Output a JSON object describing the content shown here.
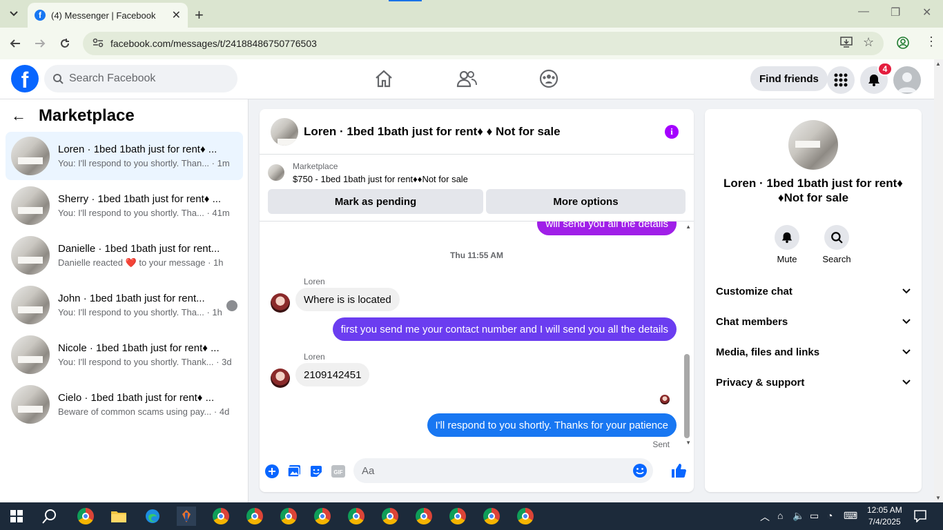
{
  "browser": {
    "tab_title": "(4) Messenger | Facebook",
    "url": "facebook.com/messages/t/24188486750776503"
  },
  "fb_header": {
    "search_placeholder": "Search Facebook",
    "find_friends": "Find friends",
    "notification_count": "4"
  },
  "left_panel": {
    "title": "Marketplace",
    "conversations": [
      {
        "name": "Loren · 1bed 1bath just for rent♦ ...",
        "preview": "You: I'll respond to you shortly. Than...",
        "time": "· 1m"
      },
      {
        "name": "Sherry · 1bed 1bath just for rent♦ ...",
        "preview": "You: I'll respond to you shortly. Tha...",
        "time": "· 41m"
      },
      {
        "name": "Danielle · 1bed 1bath just for rent...",
        "preview": "Danielle reacted ❤️ to your message",
        "time": "· 1h"
      },
      {
        "name": "John · 1bed 1bath just for rent...",
        "preview": "You: I'll respond to you shortly. Tha...",
        "time": "· 1h"
      },
      {
        "name": "Nicole · 1bed 1bath just for rent♦ ...",
        "preview": "You: I'll respond to you shortly. Thank...",
        "time": "· 3d"
      },
      {
        "name": "Cielo · 1bed 1bath just for rent♦ ...",
        "preview": "Beware of common scams using pay...",
        "time": "· 4d"
      }
    ]
  },
  "chat": {
    "header_name": "Loren · 1bed 1bath just for rent♦ ♦ Not for sale",
    "marketplace_label": "Marketplace",
    "listing": "$750 - 1bed 1bath just for rent♦♦Not for sale",
    "mark_pending": "Mark as pending",
    "more_options": "More options",
    "messages": {
      "partial_out": "will send you all the details",
      "timestamp": "Thu 11:55 AM",
      "sender1": "Loren",
      "in1": "Where is is located",
      "out1": "first you send me your contact number and I will send you all the details",
      "sender2": "Loren",
      "in2": "2109142451",
      "out2": "I'll respond to you shortly. Thanks for your patience",
      "status": "Sent"
    },
    "composer_placeholder": "Aa"
  },
  "right_panel": {
    "name_line1": "Loren · 1bed 1bath just for rent♦",
    "name_line2": "♦Not for sale",
    "mute": "Mute",
    "search": "Search",
    "sections": [
      "Customize chat",
      "Chat members",
      "Media, files and links",
      "Privacy & support"
    ]
  },
  "taskbar": {
    "time": "12:05 AM",
    "date": "7/4/2025"
  },
  "colors": {
    "fb_blue": "#0866ff",
    "purple_bubble": "#a01fe8",
    "violet_bubble": "#6b3df0",
    "blue_bubble": "#1877f2",
    "active_convo": "#ebf5ff"
  }
}
